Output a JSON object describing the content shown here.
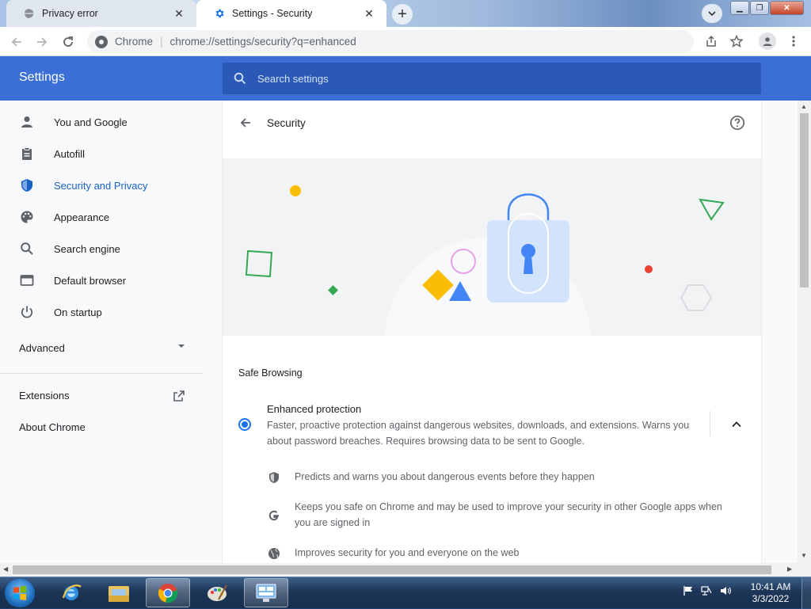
{
  "tabs": [
    {
      "title": "Privacy error",
      "icon": "globe-icon"
    },
    {
      "title": "Settings - Security",
      "icon": "gear-icon"
    }
  ],
  "toolbar": {
    "site_label": "Chrome",
    "url": "chrome://settings/security?q=enhanced"
  },
  "header": {
    "title": "Settings",
    "search_placeholder": "Search settings"
  },
  "sidebar": {
    "items": [
      {
        "label": "You and Google",
        "icon": "person-icon"
      },
      {
        "label": "Autofill",
        "icon": "clipboard-icon"
      },
      {
        "label": "Security and Privacy",
        "icon": "shield-icon",
        "selected": true
      },
      {
        "label": "Appearance",
        "icon": "palette-icon"
      },
      {
        "label": "Search engine",
        "icon": "search-icon"
      },
      {
        "label": "Default browser",
        "icon": "browser-icon"
      },
      {
        "label": "On startup",
        "icon": "power-icon"
      }
    ],
    "advanced_label": "Advanced",
    "extensions_label": "Extensions",
    "about_label": "About Chrome"
  },
  "page": {
    "title": "Security",
    "section_title": "Safe Browsing",
    "option": {
      "title": "Enhanced protection",
      "description": "Faster, proactive protection against dangerous websites, downloads, and extensions. Warns you about password breaches. Requires browsing data to be sent to Google."
    },
    "bullets": [
      {
        "text": "Predicts and warns you about dangerous events before they happen",
        "icon": "shield-icon"
      },
      {
        "text": "Keeps you safe on Chrome and may be used to improve your security in other Google apps when you are signed in",
        "icon": "google-g-icon"
      },
      {
        "text": "Improves security for you and everyone on the web",
        "icon": "globe-icon"
      }
    ]
  },
  "taskbar": {
    "time": "10:41 AM",
    "date": "3/3/2022"
  },
  "colors": {
    "accent": "#1a73e8",
    "header_blue": "#3b6fd6"
  }
}
